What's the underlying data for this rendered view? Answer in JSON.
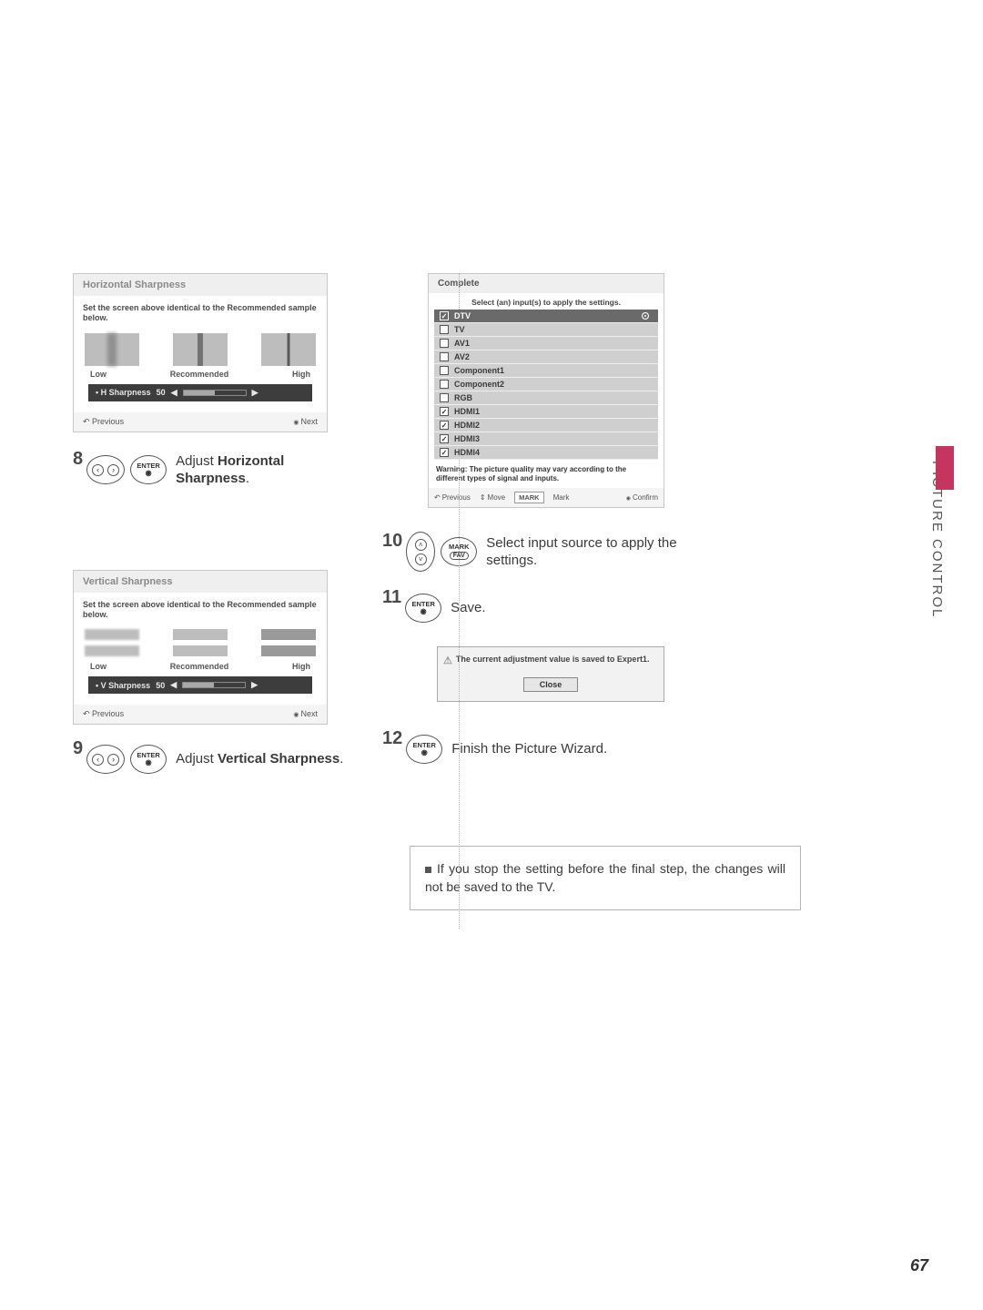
{
  "side_tab": "PICTURE CONTROL",
  "page_number": "67",
  "h_sharp": {
    "title": "Horizontal Sharpness",
    "desc": "Set the screen above identical to the Recommended sample below.",
    "low": "Low",
    "rec": "Recommended",
    "high": "High",
    "slider_label": "• H Sharpness",
    "slider_value": "50",
    "prev": "Previous",
    "next": "Next"
  },
  "v_sharp": {
    "title": "Vertical Sharpness",
    "desc": "Set the screen above identical to the Recommended sample below.",
    "low": "Low",
    "rec": "Recommended",
    "high": "High",
    "slider_label": "• V Sharpness",
    "slider_value": "50",
    "prev": "Previous",
    "next": "Next"
  },
  "step8": {
    "num": "8",
    "enter": "ENTER",
    "text_pre": "Adjust ",
    "text_bold": "Horizontal Sharpness",
    "text_post": "."
  },
  "step9": {
    "num": "9",
    "enter": "ENTER",
    "text_pre": "Adjust ",
    "text_bold": "Vertical Sharpness",
    "text_post": "."
  },
  "complete": {
    "title": "Complete",
    "desc": "Select (an) input(s) to apply the settings.",
    "items": [
      {
        "label": "DTV",
        "checked": true,
        "selected": true
      },
      {
        "label": "TV",
        "checked": false
      },
      {
        "label": "AV1",
        "checked": false
      },
      {
        "label": "AV2",
        "checked": false
      },
      {
        "label": "Component1",
        "checked": false
      },
      {
        "label": "Component2",
        "checked": false
      },
      {
        "label": "RGB",
        "checked": false
      },
      {
        "label": "HDMI1",
        "checked": true
      },
      {
        "label": "HDMI2",
        "checked": true
      },
      {
        "label": "HDMI3",
        "checked": true
      },
      {
        "label": "HDMI4",
        "checked": true
      }
    ],
    "warning": "Warning: The picture quality may vary according to the different types of signal and inputs.",
    "nav_prev": "Previous",
    "nav_move": "Move",
    "nav_mark_btn": "MARK",
    "nav_mark": "Mark",
    "nav_confirm": "Confirm"
  },
  "step10": {
    "num": "10",
    "mark": "MARK",
    "fav": "FAV",
    "text": "Select input source to apply the settings."
  },
  "step11": {
    "num": "11",
    "enter": "ENTER",
    "text": "Save."
  },
  "saved": {
    "msg": "The current adjustment value is saved to Expert1.",
    "close": "Close"
  },
  "step12": {
    "num": "12",
    "enter": "ENTER",
    "text": "Finish the Picture Wizard."
  },
  "note": "If you stop the setting before the final step, the changes will not be saved to the TV."
}
